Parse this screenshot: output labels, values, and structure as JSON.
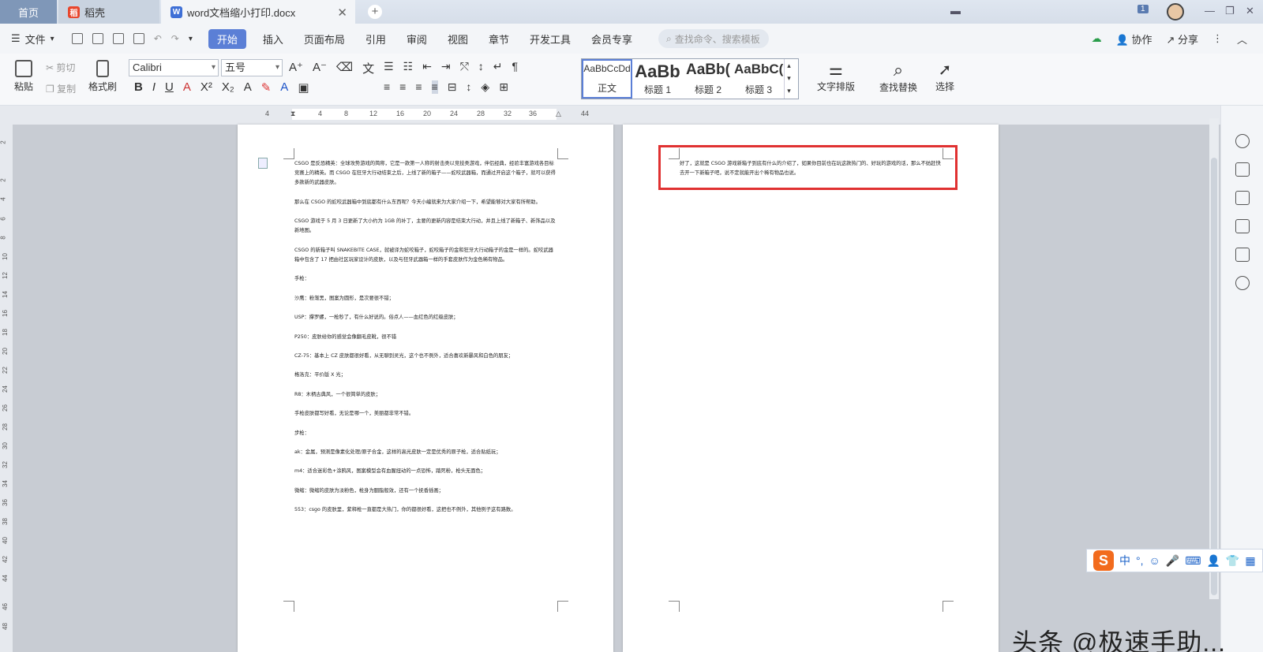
{
  "titlebar": {
    "tabs": [
      {
        "label": "首页"
      },
      {
        "label": "稻壳"
      },
      {
        "label": "word文档缩小打印.docx"
      }
    ],
    "badge": "1"
  },
  "menubar": {
    "file_label": "文件",
    "items": [
      "开始",
      "插入",
      "页面布局",
      "引用",
      "审阅",
      "视图",
      "章节",
      "开发工具",
      "会员专享"
    ],
    "search_placeholder": "查找命令、搜索模板",
    "collab_label": "协作",
    "share_label": "分享"
  },
  "ribbon": {
    "paste": "粘贴",
    "cut": "剪切",
    "copy": "复制",
    "format_painter": "格式刷",
    "font_name": "Calibri",
    "font_size": "五号",
    "styles": [
      {
        "preview": "AaBbCcDd",
        "label": "正文"
      },
      {
        "preview": "AaBb",
        "label": "标题 1"
      },
      {
        "preview": "AaBb(",
        "label": "标题 2"
      },
      {
        "preview": "AaBbC(",
        "label": "标题 3"
      }
    ],
    "text_layout": "文字排版",
    "find_replace": "查找替换",
    "select": "选择"
  },
  "ruler": {
    "h_ticks": [
      "4",
      "2",
      "4",
      "8",
      "12",
      "16",
      "20",
      "24",
      "28",
      "32",
      "36",
      "44"
    ],
    "v_ticks": [
      "2",
      "2",
      "4",
      "6",
      "8",
      "10",
      "12",
      "14",
      "16",
      "18",
      "20",
      "22",
      "24",
      "26",
      "28",
      "30",
      "32",
      "34",
      "36",
      "38",
      "40",
      "42",
      "44",
      "46",
      "48"
    ]
  },
  "page1": {
    "paragraphs": [
      "CSGO 是反恐精英：全球攻势游戏的简称，它是一款第一人称的射击类以竞技类游戏，伴侣经典，经验丰富游戏各目标竞赛上的精英。而 CSGO 在狂牙大行动结束之后，上线了新的箱子——蛇咬武器箱，而通过开启这个箱子，就可以获得多款新的武器皮肤。",
      "那么在 CSGO 的蛇咬武器箱中到底都有什么东西呢？今天小编就来为大家介绍一下，希望能够对大家有所帮助。",
      "CSGO 游戏于 5 月 3 日更新了大小约为 1GB 的补丁，主要的更新内容是结束大行动，并且上线了新箱子、新饰品以及新地图。",
      "CSGO 的新箱子叫 SNAKEBITE CASE，就被译为蛇咬箱子，蛇咬箱子的金和狂牙大行动箱子的金是一样的。蛇咬武器箱中包含了 17 把由社区玩家设计的皮肤，以及与狂牙武器箱一样的手套皮肤作为金色稀有物品。",
      "手枪：",
      "沙鹰：粉渐黑，图案为圆形，是次要很不错；",
      "USP：撑罗螺，一枪秒了，有什么好说的。俗点人——血红色的红级皮肤；",
      "P250：皮肤给你的感觉会像翻毛皮靴，很不错",
      "CZ-75：基本上 CZ 皮肤都很好看，从无聊到灵光，这个也不例外，适合喜欢新暴风和白色的朋友；",
      "格洛克：平价版 X 光；",
      "R8：木柄古典风，一个很简单的皮肤；",
      "手枪皮肤都写好看，无论是哪一个，美丽都非常不错。",
      "",
      "步枪：",
      "ak：金属，预测是像素化处理/原子合金，这样的高光皮肤一定是优秀的原子枪，适合贴纸玩；",
      "m4：适合迷彩色+涂鸦风，图案模型会有血腥扭动的一点恐怖，踏死粉，枪头无面色；",
      "微缩：微缩的皮肤为淡粉色，枪身为胭脂般效，还有一个抚香插画；",
      "553：csgo 的皮肤里，紫释枪一直都是大热门，你的都很好看，这把也不例外，其他例子这有路数。"
    ]
  },
  "page2": {
    "text": "好了，这就是 CSGO 游戏新箱子到底有什么的介绍了，如果你目前也在玩这款热门的、好玩的游戏的话，那么不妨赶快去开一下新箱子吧，说不定就能开出个稀有物品也说。"
  },
  "ime": {
    "label": "中"
  },
  "watermark": "头条 @极速手助..."
}
